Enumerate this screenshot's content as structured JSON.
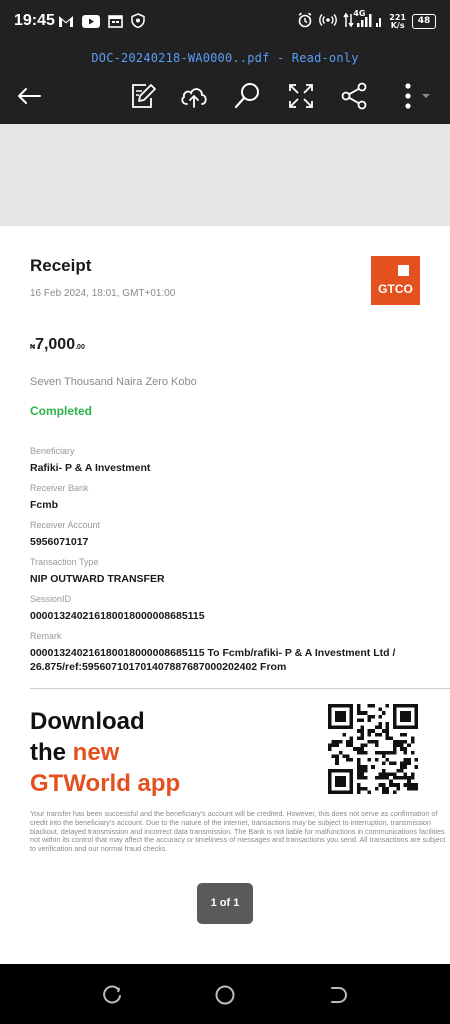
{
  "status_bar": {
    "time": "19:45",
    "network": "4G",
    "speed_top": "221",
    "speed_bottom": "K/s",
    "battery": "48"
  },
  "toolbar": {
    "document_title": "DOC-20240218-WA0000..pdf - Read-only"
  },
  "receipt": {
    "title": "Receipt",
    "date": "16 Feb 2024, 18:01, GMT+01:00",
    "logo_text": "GTCO",
    "amount_currency": "₦",
    "amount_main": "7,000",
    "amount_decimal": ".00",
    "amount_words": "Seven Thousand  Naira Zero Kobo",
    "status": "Completed",
    "fields": [
      {
        "label": "Beneficiary",
        "value": "Rafiki- P & A Investment"
      },
      {
        "label": "Receiver Bank",
        "value": "Fcmb"
      },
      {
        "label": "Receiver Account",
        "value": "5956071017"
      },
      {
        "label": "Transaction Type",
        "value": "NIP OUTWARD TRANSFER"
      },
      {
        "label": "SessionID",
        "value": "000013240216180018000008685115"
      },
      {
        "label": "Remark",
        "value": "000013240216180018000008685115 To Fcmb/rafiki- P & A Investment Ltd / 26.875/ref:595607101701407887687000202402 From"
      }
    ]
  },
  "promo": {
    "line1": "Download",
    "line2_prefix": "the ",
    "line2_accent": "new",
    "line3": "GTWorld app"
  },
  "disclaimer": "Your transfer has been successful and the beneficiary's account will be credited. However, this does not serve as confirmation of credit into the beneficiary's account. Due to the nature of the internet, transactions may be subject to interruption, transmission blackout, delayed transmission and incorrect data transmission. The Bank is not liable for malfunctions in communications facilities not within its control that may affect the accuracy or timeliness of messages and transactions you send. All transactions are subject to verification and our normal fraud checks.",
  "page_indicator": "1 of 1",
  "colors": {
    "accent": "#e5511e",
    "completed": "#2cb34a",
    "title_blue": "#5b9cf5"
  }
}
